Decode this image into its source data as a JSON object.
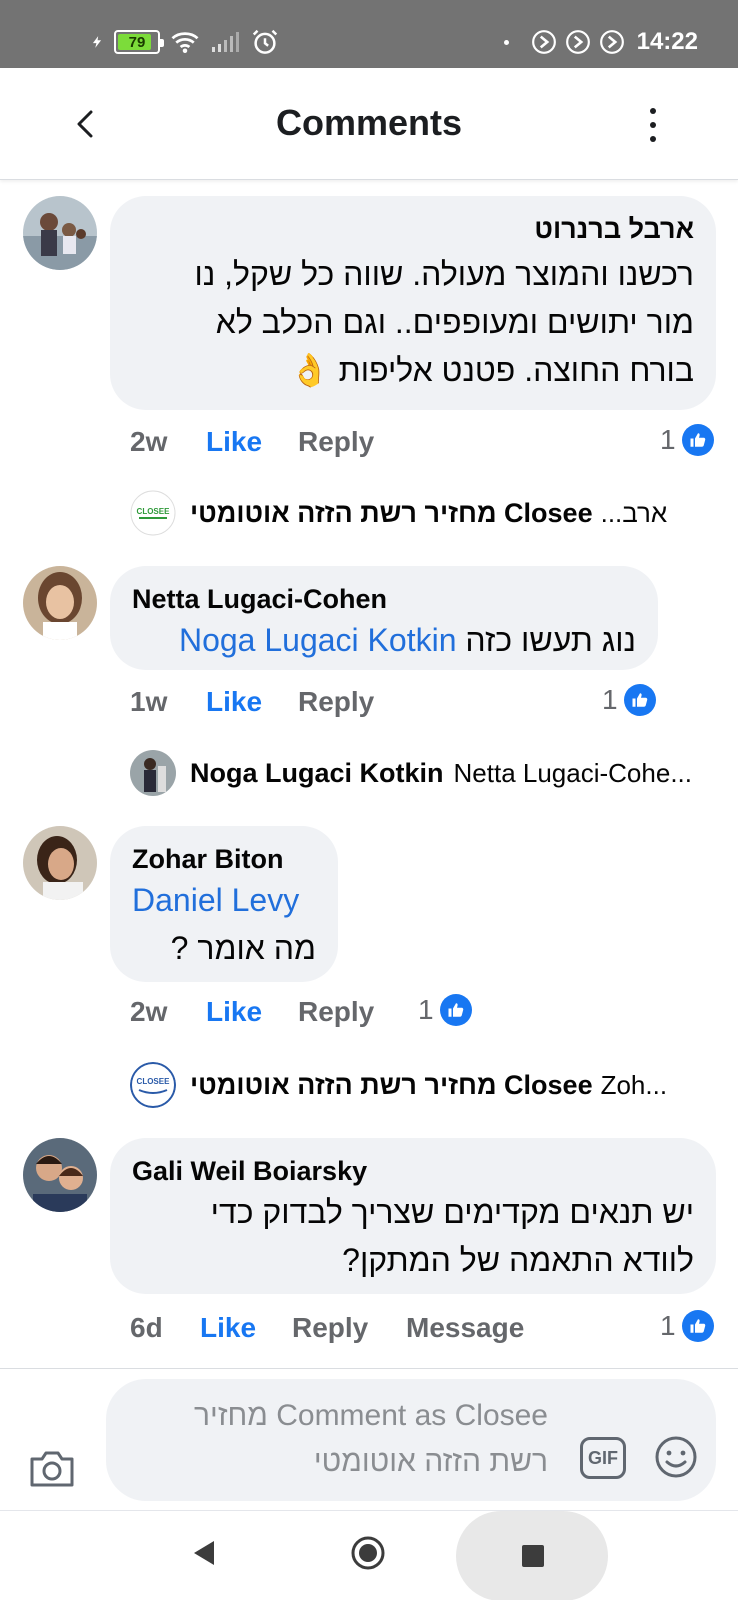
{
  "status_bar": {
    "battery": "79",
    "time": "14:22",
    "icons": [
      "flash-icon",
      "battery-icon",
      "wifi-icon",
      "signal-icon",
      "alarm-icon",
      "dot-icon",
      "app-notify-icon",
      "app-notify-icon",
      "app-notify-icon"
    ]
  },
  "header": {
    "title": "Comments",
    "back_icon": "chevron-left-icon",
    "more_icon": "more-vertical-icon"
  },
  "comments": [
    {
      "author": "ארבל ברנרוט",
      "lines": [
        "רכשנו והמוצר מעולה. שווה כל שקל, נו",
        "מור יתושים ומעופפים.. וגם הכלב לא",
        "בורח החוצה. פטנט אליפות 👌"
      ],
      "time": "2w",
      "like": "Like",
      "reply": "Reply",
      "reactions": "1",
      "reply_preview": {
        "name": "מחזיר רשת הזזה אוטומטי Closee",
        "text": "ארב..."
      }
    },
    {
      "author": "Netta Lugaci-Cohen",
      "text_hebrew": "נוג תעשו כזה",
      "mention": "Noga Lugaci Kotkin",
      "time": "1w",
      "like": "Like",
      "reply": "Reply",
      "reactions": "1",
      "reply_preview": {
        "name": "Noga Lugaci Kotkin",
        "text": "Netta Lugaci-Cohe..."
      }
    },
    {
      "author": "Zohar Biton",
      "mention": "Daniel Levy",
      "text_hebrew": "מה אומר ?",
      "time": "2w",
      "like": "Like",
      "reply": "Reply",
      "reactions": "1",
      "reply_preview": {
        "name": "מחזיר רשת הזזה אוטומטי Closee",
        "text": "Zoh..."
      }
    },
    {
      "author": "Gali Weil Boiarsky",
      "lines": [
        "יש תנאים מקדימים שצריך לבדוק כדי",
        "לוודא התאמה של המתקן?"
      ],
      "time": "6d",
      "like": "Like",
      "reply": "Reply",
      "message": "Message",
      "reactions": "1"
    }
  ],
  "composer": {
    "placeholder_line1": "Comment as Closee מחזיר",
    "placeholder_line2": "רשת הזזה אוטומטי",
    "gif_label": "GIF",
    "camera_icon": "camera-icon",
    "emoji_icon": "emoji-icon"
  },
  "nav": {
    "back_icon": "nav-back-icon",
    "home_icon": "nav-home-icon",
    "recent_icon": "nav-recent-icon"
  },
  "logo_text": "CLOSEE"
}
